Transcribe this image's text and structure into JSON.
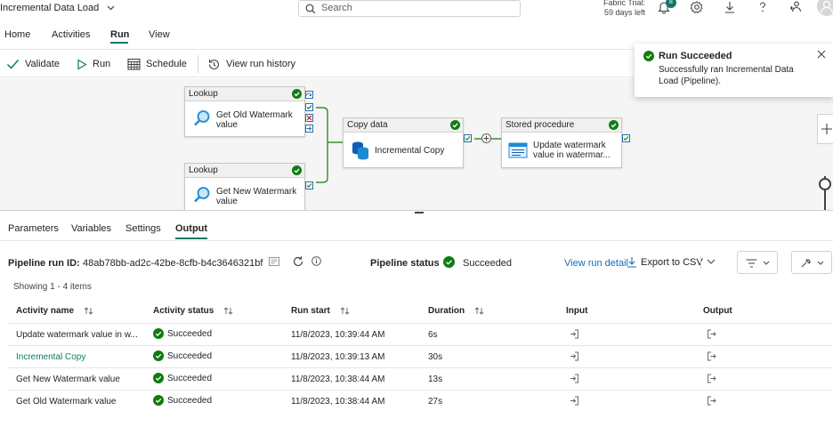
{
  "app": {
    "title": "Incremental Data Load",
    "search_placeholder": "Search",
    "trial_line1": "Fabric Trial:",
    "trial_line2": "59 days left",
    "notification_count": "8"
  },
  "ribbon": {
    "tabs": [
      "Home",
      "Activities",
      "Run",
      "View"
    ],
    "active_tab": "Run"
  },
  "toolbar": {
    "validate": "Validate",
    "run": "Run",
    "schedule": "Schedule",
    "view_run_history": "View run history"
  },
  "canvas": {
    "nodes": [
      {
        "type": "Lookup",
        "name": "Get Old Watermark value"
      },
      {
        "type": "Lookup",
        "name": "Get New Watermark value"
      },
      {
        "type": "Copy data",
        "name": "Incremental Copy"
      },
      {
        "type": "Stored procedure",
        "name": "Update watermark value in watermar..."
      }
    ]
  },
  "toast": {
    "title": "Run Succeeded",
    "message": "Successfully ran Incremental Data Load (Pipeline)."
  },
  "bottom_tabs": [
    "Parameters",
    "Variables",
    "Settings",
    "Output"
  ],
  "active_bottom_tab": "Output",
  "run_info": {
    "run_id_label": "Pipeline run ID:",
    "run_id": "48ab78bb-ad2c-42be-8cfb-b4c3646321bf",
    "status_label": "Pipeline status",
    "status": "Succeeded",
    "view_run_detail": "View run detail",
    "export": "Export to CSV",
    "showing": "Showing 1 - 4 items"
  },
  "table": {
    "headers": [
      "Activity name",
      "Activity status",
      "Run start",
      "Duration",
      "Input",
      "Output"
    ],
    "rows": [
      {
        "name": "Update watermark value in w...",
        "status": "Succeeded",
        "run_start": "11/8/2023, 10:39:44 AM",
        "duration": "6s"
      },
      {
        "name": "Incremental Copy",
        "status": "Succeeded",
        "run_start": "11/8/2023, 10:39:13 AM",
        "duration": "30s"
      },
      {
        "name": "Get New Watermark value",
        "status": "Succeeded",
        "run_start": "11/8/2023, 10:38:44 AM",
        "duration": "13s"
      },
      {
        "name": "Get Old Watermark value",
        "status": "Succeeded",
        "run_start": "11/8/2023, 10:38:44 AM",
        "duration": "27s"
      }
    ]
  },
  "colors": {
    "accent": "#117865",
    "success": "#107c10",
    "link": "#0f6cbd",
    "port": "#2b6cb0",
    "fail": "#c50f1f"
  }
}
